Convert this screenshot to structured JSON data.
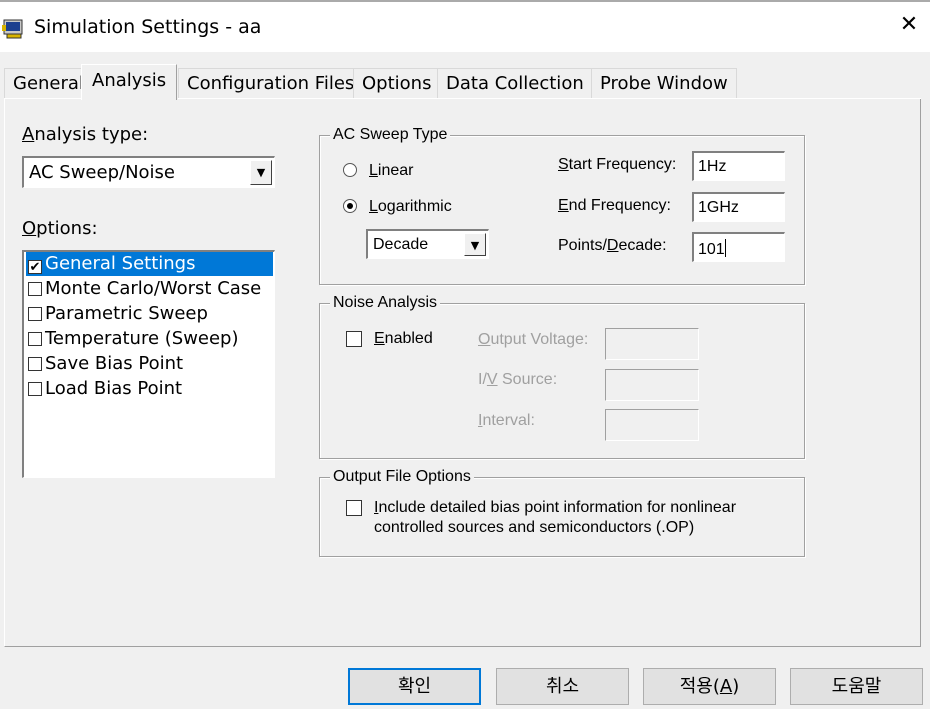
{
  "window": {
    "title": "Simulation Settings - aa"
  },
  "tabs": [
    {
      "label": "General"
    },
    {
      "label": "Analysis"
    },
    {
      "label": "Configuration Files"
    },
    {
      "label": "Options"
    },
    {
      "label": "Data Collection"
    },
    {
      "label": "Probe Window"
    }
  ],
  "analysis_type": {
    "label_pre": "",
    "label_key": "A",
    "label_post": "nalysis type:",
    "selected": "AC Sweep/Noise"
  },
  "options": {
    "label_key": "O",
    "label_post": "ptions:",
    "items": [
      {
        "label": "General Settings",
        "checked": true,
        "selected": true
      },
      {
        "label": "Monte Carlo/Worst Case",
        "checked": false
      },
      {
        "label": "Parametric Sweep",
        "checked": false
      },
      {
        "label": "Temperature (Sweep)",
        "checked": false
      },
      {
        "label": "Save Bias Point",
        "checked": false
      },
      {
        "label": "Load Bias Point",
        "checked": false
      }
    ]
  },
  "ac_sweep": {
    "group_label": "AC Sweep Type",
    "linear": {
      "pre": "",
      "key": "L",
      "post": "inear"
    },
    "logarithmic": {
      "pre": "",
      "key": "L",
      "post": "ogarithmic"
    },
    "log_unit": "Decade",
    "start": {
      "pre": "",
      "key": "S",
      "post": "tart Frequency:",
      "value": "1Hz"
    },
    "end": {
      "pre": "",
      "key": "E",
      "post": "nd Frequency:",
      "value": "1GHz"
    },
    "points": {
      "pre": "Points/",
      "key": "D",
      "post": "ecade:",
      "value": "101"
    }
  },
  "noise": {
    "group_label": "Noise Analysis",
    "enabled": {
      "pre": "",
      "key": "E",
      "post": "nabled"
    },
    "output_voltage": {
      "pre": "",
      "key": "O",
      "post": "utput Voltage:"
    },
    "iv_source": {
      "pre": "I/",
      "key": "V",
      "post": " Source:"
    },
    "interval": {
      "pre": "",
      "key": "I",
      "post": "nterval:"
    }
  },
  "output_file": {
    "group_label": "Output File Options",
    "include_line1_pre": "",
    "include_key": "I",
    "include_line1_post": "nclude detailed bias point information for nonlinear",
    "include_line2": "controlled sources and semiconductors (.OP)"
  },
  "buttons": {
    "ok": "확인",
    "cancel": "취소",
    "apply_pre": "적용(",
    "apply_key": "A",
    "apply_post": ")",
    "help": "도움말"
  }
}
